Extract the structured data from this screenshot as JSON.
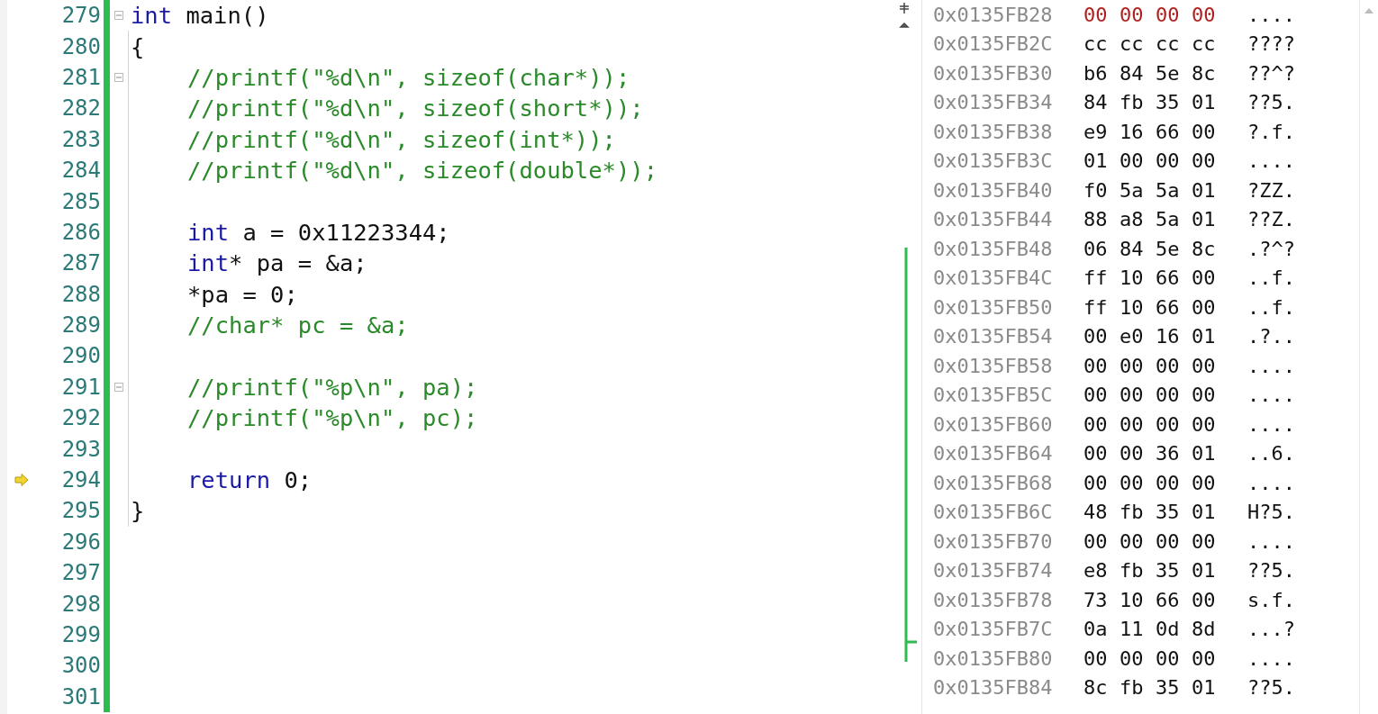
{
  "editor": {
    "lines": [
      {
        "number": "279",
        "current": false,
        "fold": true,
        "tokens": [
          {
            "kind": "keyword",
            "text": "int"
          },
          {
            "kind": "plain",
            "text": " main()"
          }
        ]
      },
      {
        "number": "280",
        "current": false,
        "fold": false,
        "tokens": [
          {
            "kind": "plain",
            "text": "{"
          }
        ],
        "children": [
          {
            "number": "281",
            "current": false,
            "fold": true,
            "tokens": [
              {
                "kind": "comment",
                "text": "//printf(\"%d\\n\", sizeof(char*));"
              }
            ]
          },
          {
            "number": "282",
            "current": false,
            "fold": false,
            "tokens": [
              {
                "kind": "comment",
                "text": "//printf(\"%d\\n\", sizeof(short*));"
              }
            ]
          },
          {
            "number": "283",
            "current": false,
            "fold": false,
            "tokens": [
              {
                "kind": "comment",
                "text": "//printf(\"%d\\n\", sizeof(int*));"
              }
            ]
          },
          {
            "number": "284",
            "current": false,
            "fold": false,
            "tokens": [
              {
                "kind": "comment",
                "text": "//printf(\"%d\\n\", sizeof(double*));"
              }
            ]
          },
          {
            "number": "285",
            "current": false,
            "fold": false
          },
          {
            "number": "286",
            "current": false,
            "fold": false,
            "tokens": [
              {
                "kind": "keyword",
                "text": "int"
              },
              {
                "kind": "plain",
                "text": " a = 0x11223344;"
              }
            ]
          },
          {
            "number": "287",
            "current": false,
            "fold": false,
            "tokens": [
              {
                "kind": "keyword",
                "text": "int"
              },
              {
                "kind": "plain",
                "text": "* pa = &a;"
              }
            ]
          },
          {
            "number": "288",
            "current": false,
            "fold": false,
            "tokens": [
              {
                "kind": "plain",
                "text": "*pa = 0;"
              }
            ]
          },
          {
            "number": "289",
            "current": false,
            "fold": false,
            "tokens": [
              {
                "kind": "comment",
                "text": "//char* pc = &a;"
              }
            ]
          },
          {
            "number": "290",
            "current": false,
            "fold": false
          },
          {
            "number": "291",
            "current": false,
            "fold": true,
            "tokens": [
              {
                "kind": "comment",
                "text": "//printf(\"%p\\n\", pa);"
              }
            ]
          },
          {
            "number": "292",
            "current": false,
            "fold": false,
            "tokens": [
              {
                "kind": "comment",
                "text": "//printf(\"%p\\n\", pc);"
              }
            ]
          },
          {
            "number": "293",
            "current": false,
            "fold": false
          },
          {
            "number": "294",
            "current": true,
            "fold": false,
            "tokens": [
              {
                "kind": "keyword",
                "text": "return"
              },
              {
                "kind": "plain",
                "text": " 0;"
              }
            ]
          }
        ]
      },
      {
        "number": "295",
        "current": false,
        "fold": false,
        "tokens": [
          {
            "kind": "plain",
            "text": "}"
          }
        ]
      },
      {
        "number": "296",
        "current": false,
        "fold": false
      },
      {
        "number": "297",
        "current": false,
        "fold": false
      },
      {
        "number": "298",
        "current": false,
        "fold": false
      },
      {
        "number": "299",
        "current": false,
        "fold": false
      },
      {
        "number": "300",
        "current": false,
        "fold": false
      },
      {
        "number": "301",
        "current": false,
        "fold": false
      }
    ]
  },
  "memory": {
    "rows": [
      {
        "address": "0x0135FB28",
        "bytes": [
          "00",
          "00",
          "00",
          "00"
        ],
        "ascii": "....",
        "changed": true
      },
      {
        "address": "0x0135FB2C",
        "bytes": [
          "cc",
          "cc",
          "cc",
          "cc"
        ],
        "ascii": "????",
        "changed": false
      },
      {
        "address": "0x0135FB30",
        "bytes": [
          "b6",
          "84",
          "5e",
          "8c"
        ],
        "ascii": "??^?",
        "changed": false
      },
      {
        "address": "0x0135FB34",
        "bytes": [
          "84",
          "fb",
          "35",
          "01"
        ],
        "ascii": "??5.",
        "changed": false
      },
      {
        "address": "0x0135FB38",
        "bytes": [
          "e9",
          "16",
          "66",
          "00"
        ],
        "ascii": "?.f.",
        "changed": false
      },
      {
        "address": "0x0135FB3C",
        "bytes": [
          "01",
          "00",
          "00",
          "00"
        ],
        "ascii": "....",
        "changed": false
      },
      {
        "address": "0x0135FB40",
        "bytes": [
          "f0",
          "5a",
          "5a",
          "01"
        ],
        "ascii": "?ZZ.",
        "changed": false
      },
      {
        "address": "0x0135FB44",
        "bytes": [
          "88",
          "a8",
          "5a",
          "01"
        ],
        "ascii": "??Z.",
        "changed": false
      },
      {
        "address": "0x0135FB48",
        "bytes": [
          "06",
          "84",
          "5e",
          "8c"
        ],
        "ascii": ".?^?",
        "changed": false
      },
      {
        "address": "0x0135FB4C",
        "bytes": [
          "ff",
          "10",
          "66",
          "00"
        ],
        "ascii": "..f.",
        "changed": false
      },
      {
        "address": "0x0135FB50",
        "bytes": [
          "ff",
          "10",
          "66",
          "00"
        ],
        "ascii": "..f.",
        "changed": false
      },
      {
        "address": "0x0135FB54",
        "bytes": [
          "00",
          "e0",
          "16",
          "01"
        ],
        "ascii": ".?..",
        "changed": false
      },
      {
        "address": "0x0135FB58",
        "bytes": [
          "00",
          "00",
          "00",
          "00"
        ],
        "ascii": "....",
        "changed": false
      },
      {
        "address": "0x0135FB5C",
        "bytes": [
          "00",
          "00",
          "00",
          "00"
        ],
        "ascii": "....",
        "changed": false
      },
      {
        "address": "0x0135FB60",
        "bytes": [
          "00",
          "00",
          "00",
          "00"
        ],
        "ascii": "....",
        "changed": false
      },
      {
        "address": "0x0135FB64",
        "bytes": [
          "00",
          "00",
          "36",
          "01"
        ],
        "ascii": "..6.",
        "changed": false
      },
      {
        "address": "0x0135FB68",
        "bytes": [
          "00",
          "00",
          "00",
          "00"
        ],
        "ascii": "....",
        "changed": false
      },
      {
        "address": "0x0135FB6C",
        "bytes": [
          "48",
          "fb",
          "35",
          "01"
        ],
        "ascii": "H?5.",
        "changed": false
      },
      {
        "address": "0x0135FB70",
        "bytes": [
          "00",
          "00",
          "00",
          "00"
        ],
        "ascii": "....",
        "changed": false
      },
      {
        "address": "0x0135FB74",
        "bytes": [
          "e8",
          "fb",
          "35",
          "01"
        ],
        "ascii": "??5.",
        "changed": false
      },
      {
        "address": "0x0135FB78",
        "bytes": [
          "73",
          "10",
          "66",
          "00"
        ],
        "ascii": "s.f.",
        "changed": false
      },
      {
        "address": "0x0135FB7C",
        "bytes": [
          "0a",
          "11",
          "0d",
          "8d"
        ],
        "ascii": "...?",
        "changed": false
      },
      {
        "address": "0x0135FB80",
        "bytes": [
          "00",
          "00",
          "00",
          "00"
        ],
        "ascii": "....",
        "changed": false
      },
      {
        "address": "0x0135FB84",
        "bytes": [
          "8c",
          "fb",
          "35",
          "01"
        ],
        "ascii": "??5.",
        "changed": false
      }
    ]
  }
}
